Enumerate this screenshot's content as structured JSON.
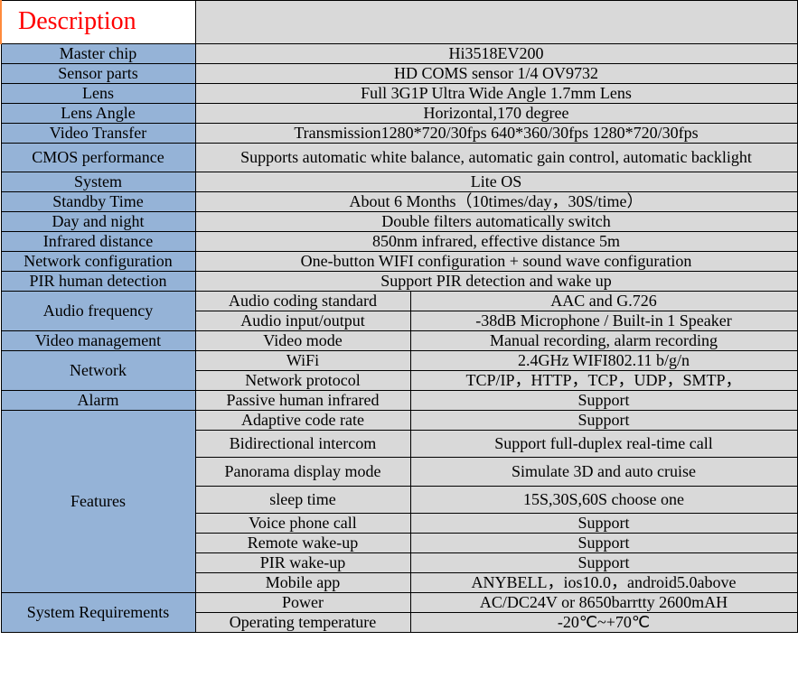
{
  "header": {
    "title": "Description"
  },
  "rows": {
    "master_chip": {
      "label": "Master chip",
      "value": "Hi3518EV200"
    },
    "sensor": {
      "label": "Sensor parts",
      "value": "HD COMS sensor 1/4  OV9732"
    },
    "lens": {
      "label": "Lens",
      "value": "Full 3G1P Ultra Wide Angle 1.7mm Lens"
    },
    "lens_angle": {
      "label": "Lens Angle",
      "value": "Horizontal,170 degree"
    },
    "video_transfer": {
      "label": "Video Transfer",
      "value": "Transmission1280*720/30fps  640*360/30fps  1280*720/30fps"
    },
    "cmos": {
      "label": "CMOS performance",
      "value": "Supports automatic white balance, automatic gain control, automatic backlight"
    },
    "system": {
      "label": "System",
      "value": "Lite OS"
    },
    "standby": {
      "label": "Standby Time",
      "value": "About 6 Months（10times/day，30S/time）"
    },
    "day_night": {
      "label": "Day and night",
      "value": "Double filters automatically switch"
    },
    "ir_distance": {
      "label": "Infrared distance",
      "value": "850nm infrared, effective distance 5m"
    },
    "net_config": {
      "label": "Network configuration",
      "value": "One-button WIFI configuration + sound wave configuration"
    },
    "pir": {
      "label": "PIR human detection",
      "value": "Support PIR detection and wake up"
    },
    "audio_freq": {
      "label": "Audio frequency",
      "r1": {
        "sub": "Audio coding standard",
        "val": "AAC and G.726"
      },
      "r2": {
        "sub": "Audio input/output",
        "val": "-38dB Microphone / Built-in 1 Speaker"
      }
    },
    "video_mgmt": {
      "label": "Video management",
      "sub": "Video mode",
      "val": "Manual recording, alarm recording"
    },
    "network": {
      "label": "Network",
      "r1": {
        "sub": "WiFi",
        "val": "2.4GHz WIFI802.11 b/g/n"
      },
      "r2": {
        "sub": "Network protocol",
        "val": "TCP/IP，HTTP，TCP，UDP，SMTP，"
      }
    },
    "alarm": {
      "label": "Alarm",
      "sub": "Passive human infrared",
      "val": "Support"
    },
    "features": {
      "label": "Features",
      "r1": {
        "sub": "Adaptive code rate",
        "val": "Support"
      },
      "r2": {
        "sub": "Bidirectional intercom",
        "val": "Support full-duplex real-time call"
      },
      "r3": {
        "sub": "Panorama display mode",
        "val": "Simulate 3D and auto cruise"
      },
      "r4": {
        "sub": "sleep time",
        "val": "15S,30S,60S choose one"
      },
      "r5": {
        "sub": "Voice phone call",
        "val": "Support"
      },
      "r6": {
        "sub": "Remote wake-up",
        "val": "Support"
      },
      "r7": {
        "sub": "PIR wake-up",
        "val": "Support"
      },
      "r8": {
        "sub": "Mobile app",
        "val": "ANYBELL，ios10.0，android5.0above"
      }
    },
    "sysreq": {
      "label": "System Requirements",
      "r1": {
        "sub": "Power",
        "val": "AC/DC24V or 8650barrtty 2600mAH"
      },
      "r2": {
        "sub": "Operating temperature",
        "val": "-20℃~+70℃"
      }
    }
  }
}
